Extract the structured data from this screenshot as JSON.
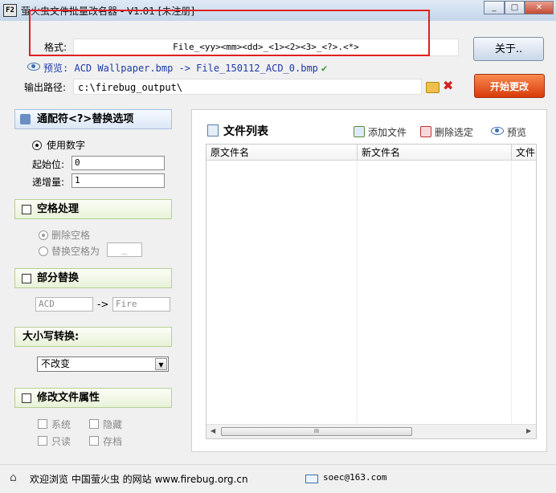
{
  "window": {
    "title": "萤火虫文件批量改名器 - V1.01 [未注册]",
    "icon_text": "F2",
    "controls": [
      "minimize-icon",
      "maximize-icon",
      "close-icon"
    ]
  },
  "format": {
    "label": "格式:",
    "value": "File_<yy><mm><dd>_<1><2><3>_<?>.<*>"
  },
  "preview": {
    "label": "预览:",
    "value": "ACD Wallpaper.bmp -> File_150112_ACD_0.bmp",
    "ok_icon": "check-icon"
  },
  "output": {
    "label": "输出路径:",
    "value": "c:\\firebug_output\\"
  },
  "buttons": {
    "about": "关于..",
    "start": "开始更改"
  },
  "wildcard": {
    "title": "通配符<?>替换选项",
    "use_numbers": "使用数字",
    "start_label": "起始位:",
    "start_value": "0",
    "step_label": "递增量:",
    "step_value": "1"
  },
  "space": {
    "title": "空格处理",
    "remove": "删除空格",
    "replace": "替换空格为",
    "replace_value": "_"
  },
  "partial": {
    "title": "部分替换",
    "from_value": "ACD",
    "arrow": "->",
    "to_value": "Fire"
  },
  "case": {
    "title": "大小写转换:",
    "selected": "不改变"
  },
  "attrs": {
    "title": "修改文件属性",
    "system": "系统",
    "hidden": "隐藏",
    "readonly": "只读",
    "archive": "存档"
  },
  "filelist": {
    "title": "文件列表",
    "add": "添加文件",
    "delete": "删除选定",
    "preview": "预览",
    "columns": [
      "原文件名",
      "新文件名",
      "文件"
    ],
    "scroll_thumb_glyph": "III"
  },
  "status": {
    "text": "欢迎浏览 中国萤火虫 的网站 www.firebug.org.cn",
    "email": "soec@163.com"
  },
  "colors": {
    "start_button": "#e8501a",
    "section_border": "#b7cf95",
    "annotation_rect": "#e02020",
    "link_blue": "#1f3aa8"
  }
}
